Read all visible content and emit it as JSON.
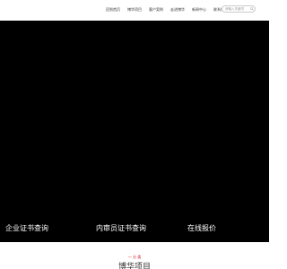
{
  "nav": {
    "items": [
      {
        "label": "回到首页"
      },
      {
        "label": "博华项目"
      },
      {
        "label": "客户案例"
      },
      {
        "label": "走进博华"
      },
      {
        "label": "新闻中心"
      },
      {
        "label": "联系博华"
      }
    ]
  },
  "search": {
    "placeholder": "请输入关键词"
  },
  "hero": {
    "links": [
      {
        "label": "企业证书查询"
      },
      {
        "label": "内审员证书查询"
      },
      {
        "label": "在线报价"
      }
    ]
  },
  "section": {
    "tag": "一 分 类",
    "title": "博华项目"
  },
  "colors": {
    "hero_bg": "#000000",
    "accent": "#d0021b",
    "text": "#333333"
  }
}
